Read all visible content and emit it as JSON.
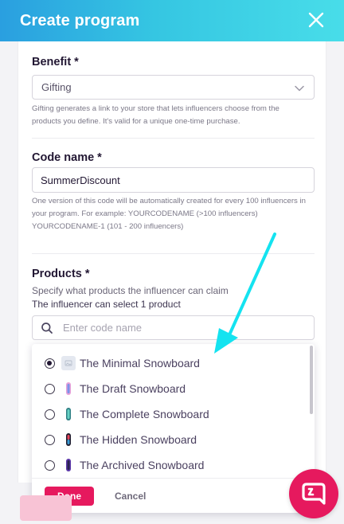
{
  "header": {
    "title": "Create program"
  },
  "benefit": {
    "label": "Benefit *",
    "selected": "Gifting",
    "help": "Gifting generates a link to your store that lets influencers choose from the products you define. It's valid for a unique one-time purchase."
  },
  "code_name": {
    "label": "Code name *",
    "value": "SummerDiscount",
    "help": "One version of this code will be automatically created for every 100 influencers in your program. For example: YOURCODENAME (>100 influencers) YOURCODENAME-1 (101 - 200 influencers)"
  },
  "products": {
    "label": "Products *",
    "subtitle": "Specify what products the influencer can claim",
    "limit_text": "The influencer can select 1 product",
    "search_placeholder": "Enter code name",
    "items": [
      {
        "label": "The Minimal Snowboard",
        "selected": true,
        "thumb": "placeholder"
      },
      {
        "label": "The Draft Snowboard",
        "selected": false,
        "thumb": "draft-board"
      },
      {
        "label": "The Complete Snowboard",
        "selected": false,
        "thumb": "complete-board"
      },
      {
        "label": "The Hidden Snowboard",
        "selected": false,
        "thumb": "hidden-board"
      },
      {
        "label": "The Archived Snowboard",
        "selected": false,
        "thumb": "archived-board"
      }
    ],
    "done_label": "Done",
    "cancel_label": "Cancel"
  },
  "colors": {
    "accent": "#e6195e",
    "header_start": "#2a9fe0",
    "header_end": "#48dde9",
    "annotation_arrow": "#14e3f0"
  },
  "icons": [
    "close-icon",
    "chevron-down-icon",
    "search-icon",
    "chat-icon"
  ]
}
